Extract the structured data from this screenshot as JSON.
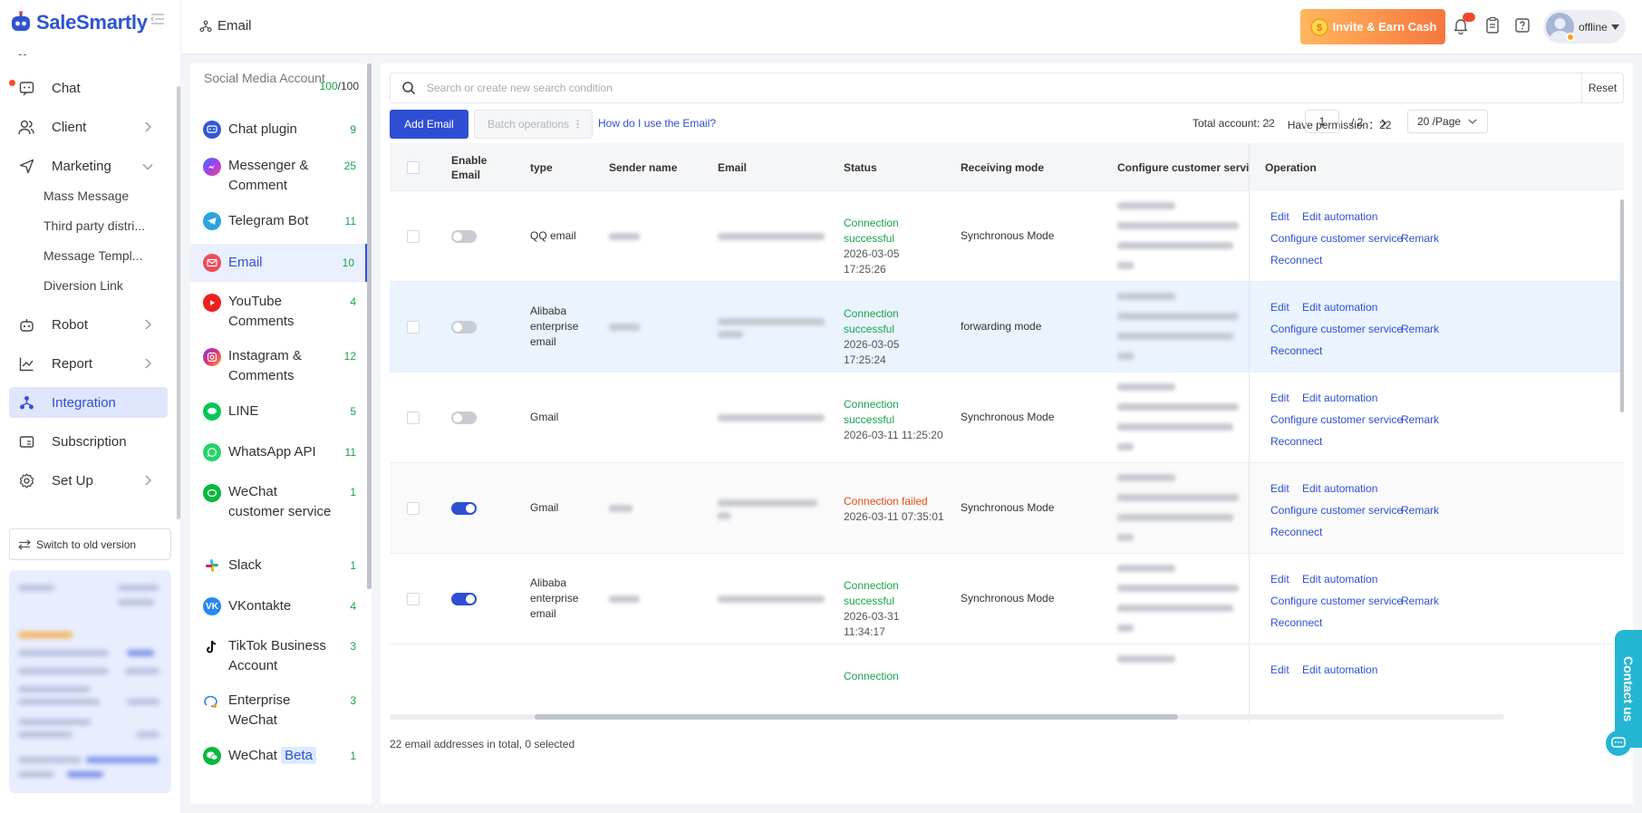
{
  "app": {
    "name": "SaleSmartly",
    "divider": "--"
  },
  "nav": {
    "items": {
      "chat": "Chat",
      "client": "Client",
      "marketing": "Marketing",
      "robot": "Robot",
      "report": "Report",
      "integration": "Integration",
      "subscription": "Subscription",
      "setup": "Set Up"
    },
    "marketing_sub": [
      "Mass Message",
      "Third party distri...",
      "Message Templ...",
      "Diversion Link"
    ],
    "switch_old": "Switch to old version"
  },
  "header": {
    "breadcrumb": "Email",
    "invite": "Invite & Earn Cash",
    "user_status": "offline"
  },
  "channels": {
    "title": "Social Media Account",
    "used": "100",
    "total": "/100",
    "items": [
      {
        "label": "Chat plugin",
        "count": "9"
      },
      {
        "label": "Messenger & Comment",
        "count": "25"
      },
      {
        "label": "Telegram Bot",
        "count": "11"
      },
      {
        "label": "Email",
        "count": "10"
      },
      {
        "label": "YouTube Comments",
        "count": "4"
      },
      {
        "label": "Instagram & Comments",
        "count": "12"
      },
      {
        "label": "LINE",
        "count": "5"
      },
      {
        "label": "WhatsApp API",
        "count": "11"
      },
      {
        "label": "WeChat customer service",
        "count": "1"
      },
      {
        "label": "Slack",
        "count": "1"
      },
      {
        "label": "VKontakte",
        "count": "4"
      },
      {
        "label": "TikTok Business Account",
        "count": "3"
      },
      {
        "label": "Enterprise WeChat",
        "count": "3"
      },
      {
        "label": "WeChat",
        "badge": "Beta",
        "count": "1"
      }
    ]
  },
  "toolbar": {
    "search_placeholder": "Search or create new search condition",
    "reset": "Reset",
    "add_email": "Add Email",
    "batch": "Batch operations",
    "howto": "How do I use the Email?",
    "total_account": "Total account: 22",
    "have_permission": "Have permission：22",
    "page": "1",
    "page_total": "/  2",
    "page_size": "20 /Page"
  },
  "table": {
    "headers": {
      "enable": "Enable Email",
      "type": "type",
      "sender": "Sender name",
      "email": "Email",
      "status": "Status",
      "receiving": "Receiving mode",
      "configure": "Configure customer service",
      "operation": "Operation"
    },
    "ops": {
      "edit": "Edit",
      "edit_automation": "Edit automation",
      "configure": "Configure customer service",
      "remark": "Remark",
      "reconnect": "Reconnect"
    },
    "rows": [
      {
        "enabled": false,
        "type": "QQ email",
        "status": "Connection successful",
        "status_ok": true,
        "time": "2026-03-05 17:25:26",
        "mode": "Synchronous Mode"
      },
      {
        "enabled": false,
        "type": "Alibaba enterprise email",
        "status": "Connection successful",
        "status_ok": true,
        "time": "2026-03-05 17:25:24",
        "mode": "forwarding mode"
      },
      {
        "enabled": false,
        "type": "Gmail",
        "status": "Connection successful",
        "status_ok": true,
        "time": "2026-03-11 11:25:20",
        "mode": "Synchronous Mode"
      },
      {
        "enabled": true,
        "type": "Gmail",
        "status": "Connection failed",
        "status_ok": false,
        "time": "2026-03-11 07:35:01",
        "mode": "Synchronous Mode"
      },
      {
        "enabled": true,
        "type": "Alibaba enterprise email",
        "status": "Connection successful",
        "status_ok": true,
        "time": "2026-03-31 11:34:17",
        "mode": "Synchronous Mode"
      },
      {
        "enabled": true,
        "type": "",
        "status": "Connection",
        "status_ok": true,
        "time": "",
        "mode": ""
      }
    ],
    "footer": "22 email addresses in total, 0 selected"
  },
  "contact": "Contact us"
}
